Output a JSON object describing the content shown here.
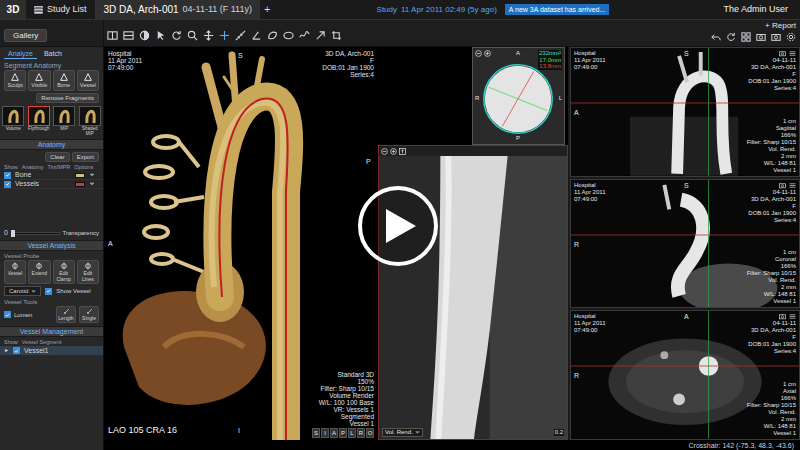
{
  "top_bar": {
    "logo": "3D",
    "study_list": "Study List",
    "tabs": [
      {
        "label": "3D DA, Arch-001",
        "detail": "04-11-11 (F 111y)",
        "selected": true
      }
    ],
    "add_tab": "+",
    "study_label": "Study",
    "study_date": "11 Apr 2011 02:49 (5y ago)",
    "notification": "A new 3A dataset has arrived...",
    "user": "The Admin User"
  },
  "toolbar": {
    "gallery": "Gallery",
    "report": "+ Report"
  },
  "left_panel": {
    "tabs": [
      {
        "label": "Analyze",
        "selected": true
      },
      {
        "label": "Batch",
        "selected": false
      }
    ],
    "segment_title": "Segment Anatomy",
    "segment_tools": [
      "Sculpt",
      "Visible",
      "Bone",
      "Vessel"
    ],
    "remove_fragments": "Remove Fragments",
    "presets": [
      {
        "label": "Volume",
        "selected": false
      },
      {
        "label": "Flythrough",
        "selected": true
      },
      {
        "label": "MIP",
        "selected": false
      },
      {
        "label": "Shaded MIP",
        "selected": false
      }
    ],
    "anatomy_title": "Anatomy",
    "clear": "Clear",
    "export": "Export",
    "anatomy_columns": [
      "Show",
      "Anatomy",
      "Tint/MPR",
      "Options"
    ],
    "anatomy_rows": [
      {
        "name": "Bone",
        "checked": true,
        "color": "#d8c07a"
      },
      {
        "name": "Vessels",
        "checked": true,
        "color": "#c83a3a"
      }
    ],
    "transparency": {
      "value": "0",
      "label": "Transparency",
      "level": 0
    },
    "vessel_title": "Vessel Analysis",
    "vessel_probe": "Vessel Probe",
    "probe_buttons": [
      "Vessel",
      "Extend",
      "Edit Clamp",
      "Edit Lines"
    ],
    "vessel_type": "Carotid",
    "show_vessel": {
      "label": "Show Vessel",
      "checked": true
    },
    "vessel_tools": "Vessel Tools",
    "lumen": {
      "label": "Lumen",
      "checked": true
    },
    "tool_buttons": [
      "Length",
      "Single"
    ],
    "management_title": "Vessel Management",
    "management_columns": [
      "Show",
      "Vessel Segment"
    ],
    "vessels": [
      {
        "name": "Vessel1",
        "checked": true
      }
    ]
  },
  "main_view": {
    "info_left": [
      "Hospital",
      "11 Apr 2011",
      "07:49:00"
    ],
    "info_right": [
      "3D DA, Arch-001",
      "F",
      "DOB:01 Jan 1900",
      "Series:4"
    ],
    "orientation": {
      "top": "S",
      "left": "A",
      "right": "P",
      "bottom": "I"
    },
    "angle": "LAO 105 CRA 16",
    "render_info": [
      "Standard 3D",
      "150%",
      "Filter: Sharp 10/15",
      "Volume Render",
      "W/L: 100 100 Base",
      "VR: Vessels 1",
      "Segmented",
      "Vessel 1"
    ],
    "orientation_buttons": [
      "S",
      "I",
      "A",
      "P",
      "L",
      "R",
      "O"
    ]
  },
  "curved_view": {
    "mode": "Vol. Rend.",
    "scale": "0.2"
  },
  "cross_section": {
    "measurements": [
      {
        "text": "232mm²",
        "color": "#40e0d0"
      },
      {
        "text": "17.0mm",
        "color": "#40e040"
      },
      {
        "text": "13.8mm",
        "color": "#e04040"
      }
    ],
    "orientation": {
      "top": "A",
      "bottom": "P",
      "left": "R",
      "right": "L"
    }
  },
  "side_views": [
    {
      "info_left": [
        "Hospital",
        "11 Apr 2011",
        "07:49:00"
      ],
      "info_right": [
        "04-11-11",
        "3D DA, Arch-001",
        "F",
        "DOB:01 Jan 1900",
        "Series:4"
      ],
      "scale": "1 cm",
      "details": [
        "Sagittal",
        "166%",
        "Filter: Sharp 10/15",
        "Vol. Rend.",
        "2 mm",
        "W/L: 148 81",
        "Vessel 1"
      ],
      "orientation": {
        "top": "S",
        "left": "A"
      }
    },
    {
      "info_left": [
        "Hospital",
        "11 Apr 2011",
        "07:49:00"
      ],
      "info_right": [
        "04-11-11",
        "3D DA, Arch-001",
        "F",
        "DOB:01 Jan 1900",
        "Series:4"
      ],
      "scale": "1 cm",
      "details": [
        "Coronal",
        "166%",
        "Filter: Sharp 10/15",
        "Vol. Rend.",
        "2 mm",
        "W/L: 148 81",
        "Vessel 1"
      ],
      "orientation": {
        "top": "S",
        "left": "R"
      }
    },
    {
      "info_left": [
        "Hospital",
        "11 Apr 2011",
        "07:49:00"
      ],
      "info_right": [
        "04-11-11",
        "3D DA, Arch-001",
        "F",
        "DOB:01 Jan 1900",
        "Series:4"
      ],
      "scale": "1 cm",
      "details": [
        "Axial",
        "166%",
        "Filter: Sharp 10/15",
        "Vol. Rend.",
        "2 mm",
        "W/L: 148 81",
        "Vessel 1"
      ],
      "orientation": {
        "top": "A",
        "left": "R"
      }
    }
  ],
  "status_bar": {
    "crosshair": "Crosshair: 142 (-75.3, 48.3, -43.6)"
  }
}
